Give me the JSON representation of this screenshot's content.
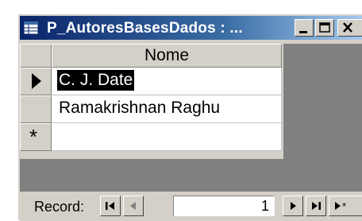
{
  "window": {
    "title": "P_AutoresBasesDados : ..."
  },
  "title_buttons": [
    "minimize-icon",
    "maximize-icon",
    "close-icon"
  ],
  "datasheet": {
    "column_header": "Nome",
    "rows": [
      {
        "indicator": "current-record-icon",
        "value": "C. J. Date",
        "selected": true
      },
      {
        "indicator": "",
        "value": "Ramakrishnan Raghu",
        "selected": false
      }
    ],
    "new_row_indicator": "*"
  },
  "navigator": {
    "label": "Record:",
    "current_record": "1",
    "buttons": [
      "first-record-icon",
      "previous-record-icon",
      "next-record-icon",
      "last-record-icon",
      "new-record-icon"
    ]
  },
  "colors": {
    "titlebar_start": "#0a246a",
    "titlebar_end": "#a6caf0",
    "face": "#d4d0c8",
    "app_workspace": "#808080"
  }
}
